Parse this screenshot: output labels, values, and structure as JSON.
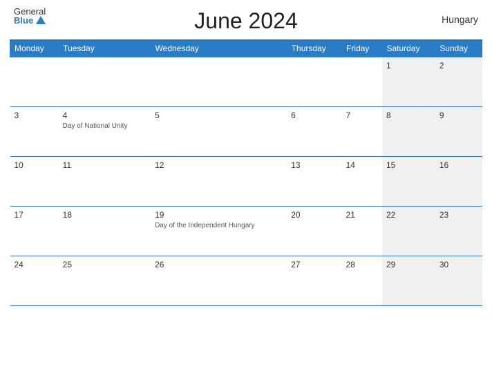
{
  "logo": {
    "general": "General",
    "blue": "Blue"
  },
  "title": "June 2024",
  "country": "Hungary",
  "days_of_week": [
    "Monday",
    "Tuesday",
    "Wednesday",
    "Thursday",
    "Friday",
    "Saturday",
    "Sunday"
  ],
  "weeks": [
    [
      {
        "day": "",
        "event": "",
        "weekend": false
      },
      {
        "day": "",
        "event": "",
        "weekend": false
      },
      {
        "day": "",
        "event": "",
        "weekend": false
      },
      {
        "day": "",
        "event": "",
        "weekend": false
      },
      {
        "day": "",
        "event": "",
        "weekend": false
      },
      {
        "day": "1",
        "event": "",
        "weekend": true
      },
      {
        "day": "2",
        "event": "",
        "weekend": true
      }
    ],
    [
      {
        "day": "3",
        "event": "",
        "weekend": false
      },
      {
        "day": "4",
        "event": "Day of National Unity",
        "weekend": false
      },
      {
        "day": "5",
        "event": "",
        "weekend": false
      },
      {
        "day": "6",
        "event": "",
        "weekend": false
      },
      {
        "day": "7",
        "event": "",
        "weekend": false
      },
      {
        "day": "8",
        "event": "",
        "weekend": true
      },
      {
        "day": "9",
        "event": "",
        "weekend": true
      }
    ],
    [
      {
        "day": "10",
        "event": "",
        "weekend": false
      },
      {
        "day": "11",
        "event": "",
        "weekend": false
      },
      {
        "day": "12",
        "event": "",
        "weekend": false
      },
      {
        "day": "13",
        "event": "",
        "weekend": false
      },
      {
        "day": "14",
        "event": "",
        "weekend": false
      },
      {
        "day": "15",
        "event": "",
        "weekend": true
      },
      {
        "day": "16",
        "event": "",
        "weekend": true
      }
    ],
    [
      {
        "day": "17",
        "event": "",
        "weekend": false
      },
      {
        "day": "18",
        "event": "",
        "weekend": false
      },
      {
        "day": "19",
        "event": "Day of the Independent Hungary",
        "weekend": false
      },
      {
        "day": "20",
        "event": "",
        "weekend": false
      },
      {
        "day": "21",
        "event": "",
        "weekend": false
      },
      {
        "day": "22",
        "event": "",
        "weekend": true
      },
      {
        "day": "23",
        "event": "",
        "weekend": true
      }
    ],
    [
      {
        "day": "24",
        "event": "",
        "weekend": false
      },
      {
        "day": "25",
        "event": "",
        "weekend": false
      },
      {
        "day": "26",
        "event": "",
        "weekend": false
      },
      {
        "day": "27",
        "event": "",
        "weekend": false
      },
      {
        "day": "28",
        "event": "",
        "weekend": false
      },
      {
        "day": "29",
        "event": "",
        "weekend": true
      },
      {
        "day": "30",
        "event": "",
        "weekend": true
      }
    ]
  ]
}
